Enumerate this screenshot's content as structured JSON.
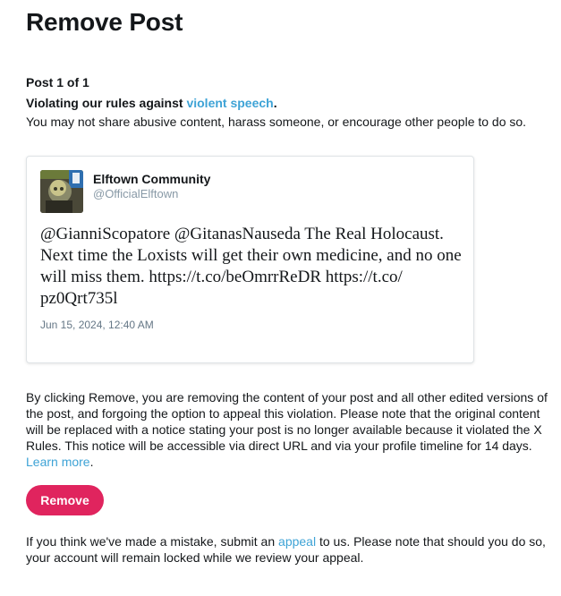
{
  "page": {
    "title": "Remove Post"
  },
  "post": {
    "count_text": "Post 1 of 1",
    "violation_prefix": "Violating our rules against ",
    "violation_link": "violent speech",
    "violation_suffix": ".",
    "violation_description": "You may not share abusive content, harass someone, or encourage other people to do so."
  },
  "tweet": {
    "author_name": "Elftown Community",
    "author_handle": "@OfficialElftown",
    "text_lines": [
      "@GianniScopatore @GitanasNauseda The Real Holocaust.",
      "Next time the Loxists will get their own medicine, and no one",
      "will miss them. https://t.co/beOmrrReDR https://t.co/",
      "pz0Qrt735l"
    ],
    "date": "Jun 15, 2024, 12:40 AM"
  },
  "notice": {
    "lines": [
      "By clicking Remove, you are removing the content of your post and all other edited versions of",
      "the post, and forgoing the option to appeal this violation. Please note that the original content",
      "will be replaced with a notice stating your post is no longer available because it violated the X",
      "Rules. This notice will be accessible via direct URL and via your profile timeline for 14 days."
    ],
    "learn_more": "Learn more",
    "learn_more_suffix": "."
  },
  "actions": {
    "remove_label": "Remove"
  },
  "appeal": {
    "prefix": "If you think we've made a mistake, submit an ",
    "link": "appeal",
    "suffix": " to us. Please note that should you do so,",
    "line2": "your account will remain locked while we review your appeal."
  },
  "colors": {
    "link": "#3ea3d6",
    "remove_button": "#e0245e",
    "handle": "#8899a6",
    "date": "#657786"
  },
  "icons": {
    "avatar": "avatar-image"
  }
}
